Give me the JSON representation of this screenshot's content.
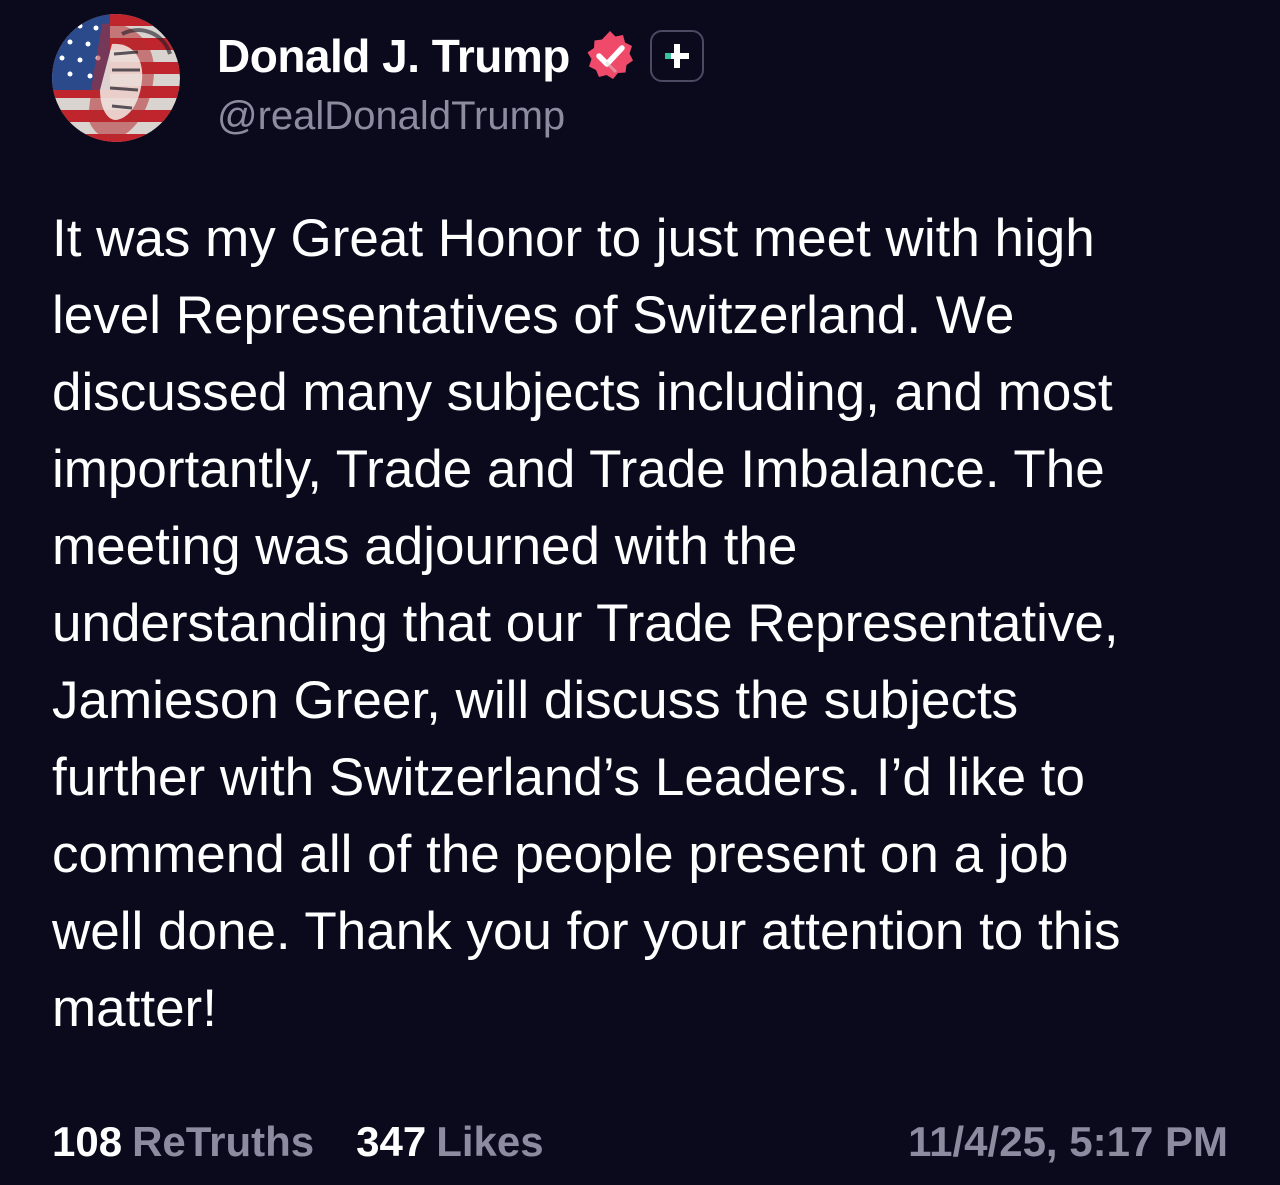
{
  "author": {
    "display_name": "Donald J. Trump",
    "handle": "@realDonaldTrump",
    "verified": true,
    "avatar_icon": "flag-portrait-avatar",
    "verified_icon": "verified-badge-icon",
    "follow_icon": "plus-icon"
  },
  "post": {
    "text": "It was my Great Honor to just meet with high\nlevel Representatives of Switzerland. We\ndiscussed many subjects including, and most\nimportantly, Trade and Trade Imbalance. The\nmeeting was adjourned with the\nunderstanding that our Trade Representative,\nJamieson Greer, will discuss the subjects\nfurther with Switzerland’s Leaders. I’d like to\ncommend all of the people present on a job\nwell done. Thank you for your attention to this\nmatter!"
  },
  "stats": {
    "retruths_count": "108",
    "retruths_label": "ReTruths",
    "likes_count": "347",
    "likes_label": "Likes",
    "timestamp": "11/4/25, 5:17 PM"
  },
  "colors": {
    "background": "#0b0a1c",
    "text": "#ffffff",
    "muted": "#8c8ba0",
    "verified_badge": "#f04a6a"
  }
}
